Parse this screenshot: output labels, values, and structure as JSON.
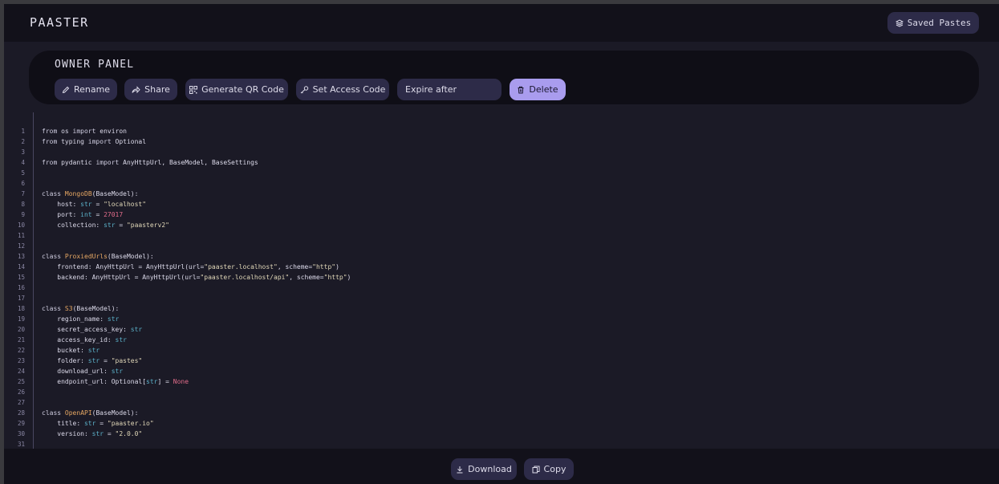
{
  "header": {
    "brand": "PAASTER",
    "saved_pastes_label": "Saved Pastes"
  },
  "owner_panel": {
    "title": "OWNER PANEL",
    "rename_label": "Rename",
    "share_label": "Share",
    "qr_label": "Generate QR Code",
    "access_label": "Set Access Code",
    "expire_label": "Expire after",
    "delete_label": "Delete"
  },
  "code": {
    "language": "python",
    "lines": [
      "from os import environ",
      "from typing import Optional",
      "",
      "from pydantic import AnyHttpUrl, BaseModel, BaseSettings",
      "",
      "",
      "class MongoDB(BaseModel):",
      "    host: str = \"localhost\"",
      "    port: int = 27017",
      "    collection: str = \"paasterv2\"",
      "",
      "",
      "class ProxiedUrls(BaseModel):",
      "    frontend: AnyHttpUrl = AnyHttpUrl(url=\"paaster.localhost\", scheme=\"http\")",
      "    backend: AnyHttpUrl = AnyHttpUrl(url=\"paaster.localhost/api\", scheme=\"http\")",
      "",
      "",
      "class S3(BaseModel):",
      "    region_name: str",
      "    secret_access_key: str",
      "    access_key_id: str",
      "    bucket: str",
      "    folder: str = \"pastes\"",
      "    download_url: str",
      "    endpoint_url: Optional[str] = None",
      "",
      "",
      "class OpenAPI(BaseModel):",
      "    title: str = \"paaster.io\"",
      "    version: str = \"2.0.0\"",
      "",
      ""
    ]
  },
  "footer": {
    "download_label": "Download",
    "copy_label": "Copy"
  },
  "colors": {
    "background": "#1b1a26",
    "bar": "#12111a",
    "button": "#2d2b48",
    "accent": "#a99cee"
  }
}
